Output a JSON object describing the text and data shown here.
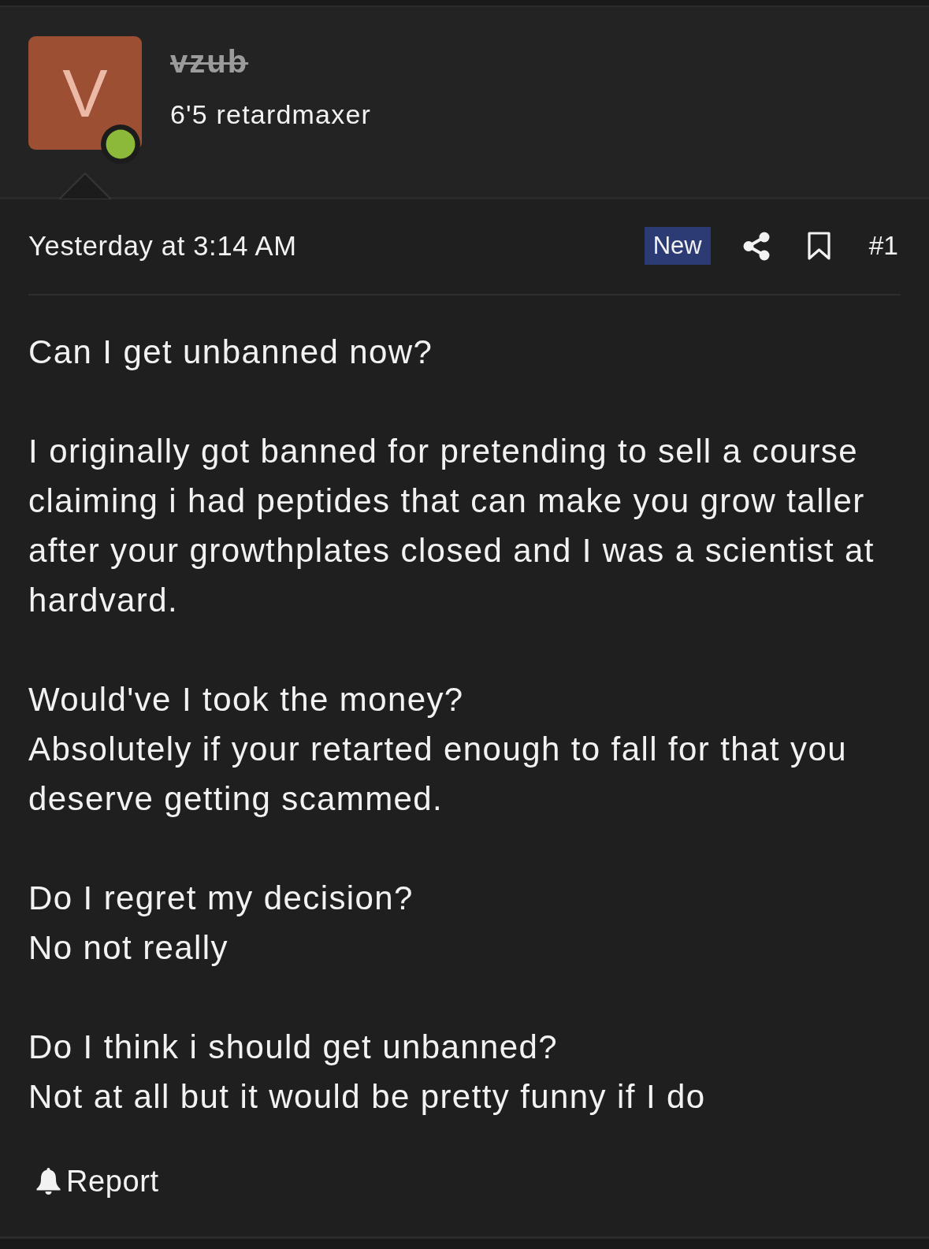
{
  "author": {
    "avatar_letter": "V",
    "online": true,
    "username": "vzub",
    "banned": true,
    "title": "6'5 retardmaxer"
  },
  "meta": {
    "time": "Yesterday at 3:14 AM",
    "badge": "New",
    "bookmarked": false,
    "post_number": "#1"
  },
  "body": [
    "Can I get unbanned now?",
    "I originally got banned for pretending to sell a course claiming i had peptides that can make you grow taller after your growthplates closed and I was a scientist at hardvard.",
    "Would've I took the money?\nAbsolutely if your retarted enough to fall for that you deserve getting scammed.",
    "Do I regret my decision?\nNo not really",
    "Do I think i should get unbanned?\nNot at all but it would be pretty funny if I do"
  ],
  "actions": [
    {
      "kind": "report",
      "label": "Report"
    }
  ]
}
